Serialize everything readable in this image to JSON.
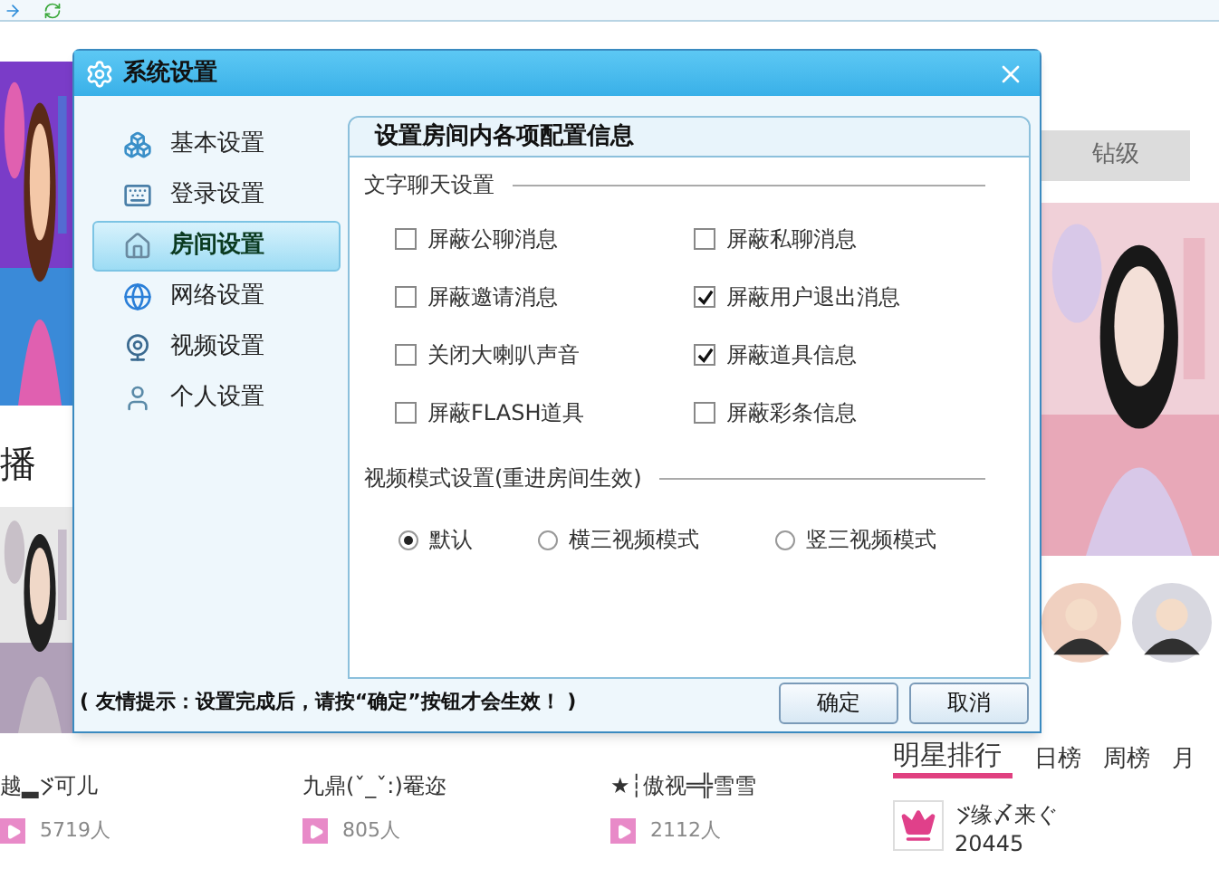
{
  "background": {
    "left_heading": "播",
    "right_tab": "钻级",
    "streamers": [
      {
        "name_parts": [
          "越▂",
          "可儿"
        ],
        "viewers": "5719人"
      },
      {
        "name": "九鼎(ˇ_ˇ:)罨迩",
        "viewers": "805人"
      },
      {
        "name": "★┆傲视═╬雪雪",
        "viewers": "2112人"
      }
    ],
    "ranking": {
      "title": "明星排行",
      "tabs": [
        {
          "label": "日榜",
          "selected": false
        },
        {
          "label": "周榜",
          "selected": false
        },
        {
          "label": "月",
          "selected": false
        }
      ],
      "top": {
        "leading_mark": true,
        "name": "缘〆来ぐ",
        "score": "20445"
      }
    }
  },
  "dialog": {
    "title": "系统设置",
    "sidebar": [
      {
        "label": "基本设置",
        "selected": false
      },
      {
        "label": "登录设置",
        "selected": false
      },
      {
        "label": "房间设置",
        "selected": true
      },
      {
        "label": "网络设置",
        "selected": false
      },
      {
        "label": "视频设置",
        "selected": false
      },
      {
        "label": "个人设置",
        "selected": false
      }
    ],
    "panel_title": "设置房间内各项配置信息",
    "chat_section": {
      "title": "文字聊天设置",
      "options": [
        {
          "label": "屏蔽公聊消息",
          "checked": false
        },
        {
          "label": "屏蔽私聊消息",
          "checked": false
        },
        {
          "label": "屏蔽邀请消息",
          "checked": false
        },
        {
          "label": "屏蔽用户退出消息",
          "checked": true
        },
        {
          "label": "关闭大喇叭声音",
          "checked": false
        },
        {
          "label": "屏蔽道具信息",
          "checked": true
        },
        {
          "label": "屏蔽FLASH道具",
          "checked": false
        },
        {
          "label": "屏蔽彩条信息",
          "checked": false
        }
      ]
    },
    "video_section": {
      "title": "视频模式设置(重进房间生效)",
      "options": [
        {
          "label": "默认",
          "selected": true
        },
        {
          "label": "横三视频模式",
          "selected": false
        },
        {
          "label": "竖三视频模式",
          "selected": false
        }
      ]
    },
    "hint": "( 友情提示：设置完成后，请按“确定”按钮才会生效！ )",
    "buttons": [
      "确定",
      "取消"
    ]
  }
}
